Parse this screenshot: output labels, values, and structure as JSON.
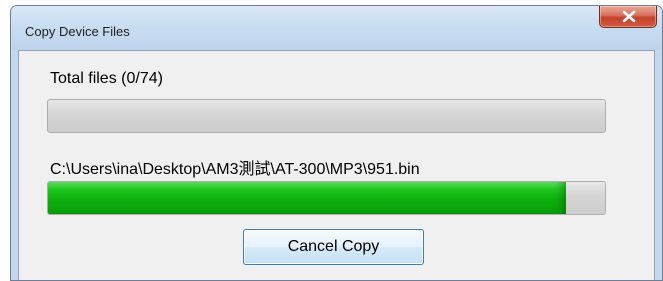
{
  "window": {
    "title": "Copy Device Files"
  },
  "dialog": {
    "total_label": "Total files (0/74)",
    "total_progress": 0.0,
    "current_file_path": "C:\\Users\\ina\\Desktop\\AM3測試\\AT-300\\MP3\\951.bin",
    "file_progress": 0.93,
    "cancel_label": "Cancel Copy"
  },
  "colors": {
    "progress_fill": "#0db00d",
    "title_bar": "#c8dcf1",
    "close_button": "#c4422b"
  },
  "icons": {
    "close": "close-x-icon"
  }
}
